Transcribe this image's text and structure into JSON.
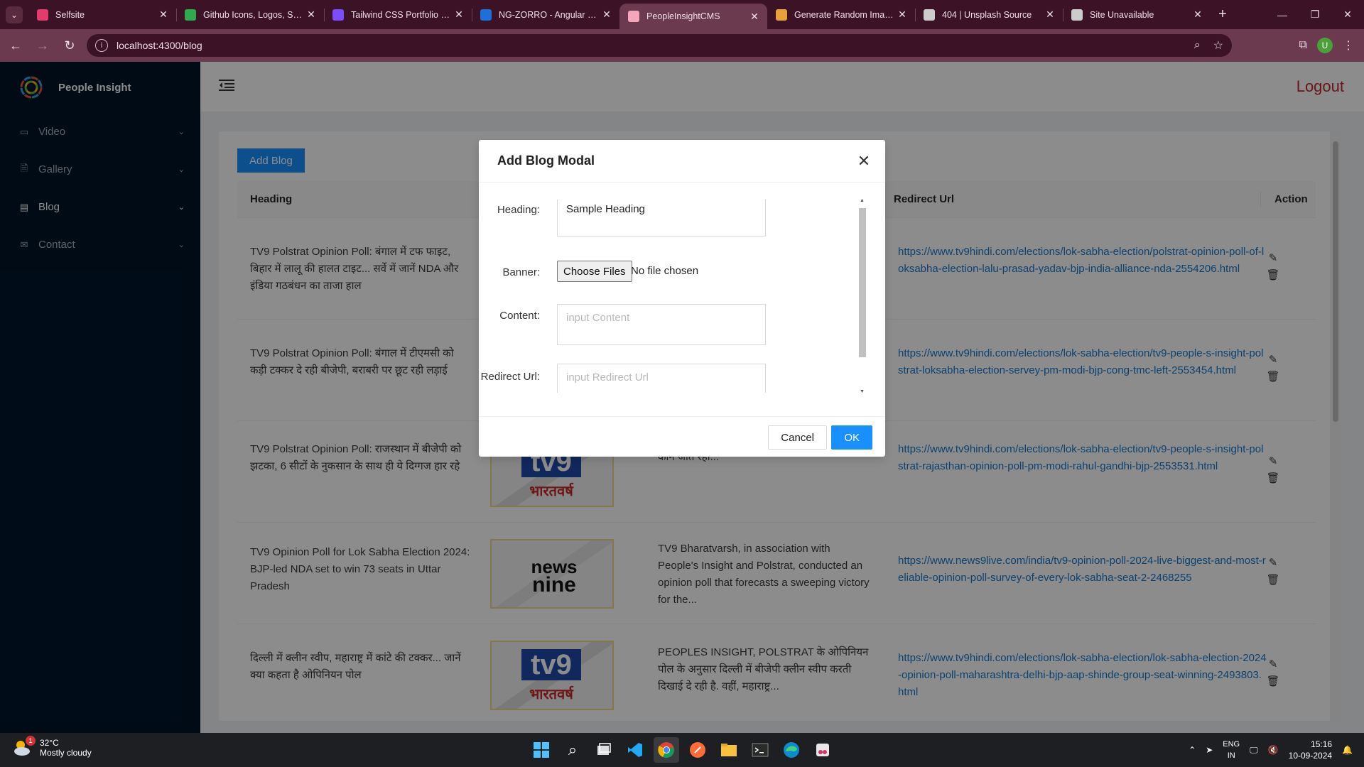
{
  "browser": {
    "tabs": [
      {
        "title": "Selfsite",
        "color": "#e23c6c",
        "active": false
      },
      {
        "title": "Github Icons, Logos, Symbols",
        "color": "#2fa84f",
        "active": false
      },
      {
        "title": "Tailwind CSS Portfolio Section",
        "color": "#7c4dff",
        "active": false
      },
      {
        "title": "NG-ZORRO - Angular UI comp",
        "color": "#1e6fd9",
        "active": false
      },
      {
        "title": "PeopleInsightCMS",
        "color": "#f4a7b9",
        "active": true
      },
      {
        "title": "Generate Random Images",
        "color": "#e8a23a",
        "active": false
      },
      {
        "title": "404 | Unsplash Source",
        "color": "#cccccc",
        "active": false
      },
      {
        "title": "Site Unavailable",
        "color": "#cccccc",
        "active": false
      }
    ],
    "url": "localhost:4300/blog",
    "profile_initial": "U"
  },
  "app": {
    "brand": "People Insight",
    "logout": "Logout",
    "menu": [
      {
        "label": "Video",
        "icon": "video-icon"
      },
      {
        "label": "Gallery",
        "icon": "gallery-icon"
      },
      {
        "label": "Blog",
        "icon": "blog-icon"
      },
      {
        "label": "Contact",
        "icon": "contact-icon"
      }
    ],
    "add_blog": "Add Blog",
    "columns": {
      "heading": "Heading",
      "redirect_url": "Redirect Url",
      "action": "Action"
    },
    "rows": [
      {
        "heading": "TV9 Polstrat Opinion Poll: बंगाल में टफ फाइट, बिहार में लालू की हालत टाइट... सर्वे में जानें NDA और इंडिया गठबंधन का ताजा हाल",
        "banner": "",
        "content": "",
        "url": "https://www.tv9hindi.com/elections/lok-sabha-election/polstrat-opinion-poll-of-loksabha-election-lalu-prasad-yadav-bjp-india-alliance-nda-2554206.html"
      },
      {
        "heading": "TV9 Polstrat Opinion Poll: बंगाल में टीएमसी को कड़ी टक्कर दे रही बीजेपी, बराबरी पर छूट रही लड़ाई",
        "banner": "",
        "content": "",
        "url": "https://www.tv9hindi.com/elections/lok-sabha-election/tv9-people-s-insight-polstrat-loksabha-election-servey-pm-modi-bjp-cong-tmc-left-2553454.html"
      },
      {
        "heading": "TV9 Polstrat Opinion Poll: राजस्थान में बीजेपी को झटका, 6 सीटों के नुकसान के साथ ही ये दिग्गज हार रहे",
        "banner": "tv9",
        "content": "Insight, Polstrat का सर्वे आ गया है. राजस्थान में कौन जीत रहा...",
        "url": "https://www.tv9hindi.com/elections/lok-sabha-election/tv9-people-s-insight-polstrat-rajasthan-opinion-poll-pm-modi-rahul-gandhi-bjp-2553531.html"
      },
      {
        "heading": "TV9 Opinion Poll for Lok Sabha Election 2024: BJP-led NDA set to win 73 seats in Uttar Pradesh",
        "banner": "news9",
        "content": "TV9 Bharatvarsh, in association with People's Insight and Polstrat, conducted an opinion poll that forecasts a sweeping victory for the...",
        "url": "https://www.news9live.com/india/tv9-opinion-poll-2024-live-biggest-and-most-reliable-opinion-poll-survey-of-every-lok-sabha-seat-2-2468255"
      },
      {
        "heading": "दिल्ली में क्लीन स्वीप, महाराष्ट्र में कांटे की टक्कर... जानें क्या कहता है ओपिनियन पोल",
        "banner": "tv9",
        "content": "PEOPLES INSIGHT, POLSTRAT के ओपिनियन पोल के अनुसार दिल्ली में बीजेपी क्लीन स्वीप करती दिखाई दे रही है. वहीं, महाराष्ट्र...",
        "url": "https://www.tv9hindi.com/elections/lok-sabha-election/lok-sabha-election-2024-opinion-poll-maharashtra-delhi-bjp-aap-shinde-group-seat-winning-2493803.html"
      }
    ],
    "banner_text": {
      "tv9": "tv9",
      "tv9_sub": "भारतवर्ष",
      "news9_a": "news",
      "news9_b": "nine"
    }
  },
  "modal": {
    "title": "Add Blog Modal",
    "heading_label": "Heading",
    "heading_value": "Sample Heading",
    "banner_label": "Banner",
    "choose_files": "Choose Files",
    "no_file": "No file chosen",
    "content_label": "Content",
    "content_placeholder": "input Content",
    "redirect_label": "Redirect Url",
    "redirect_placeholder": "input Redirect Url",
    "cancel": "Cancel",
    "ok": "OK"
  },
  "taskbar": {
    "temp": "32°C",
    "weather": "Mostly cloudy",
    "weather_badge": "1",
    "lang_a": "ENG",
    "lang_b": "IN",
    "time": "15:16",
    "date": "10-09-2024"
  }
}
